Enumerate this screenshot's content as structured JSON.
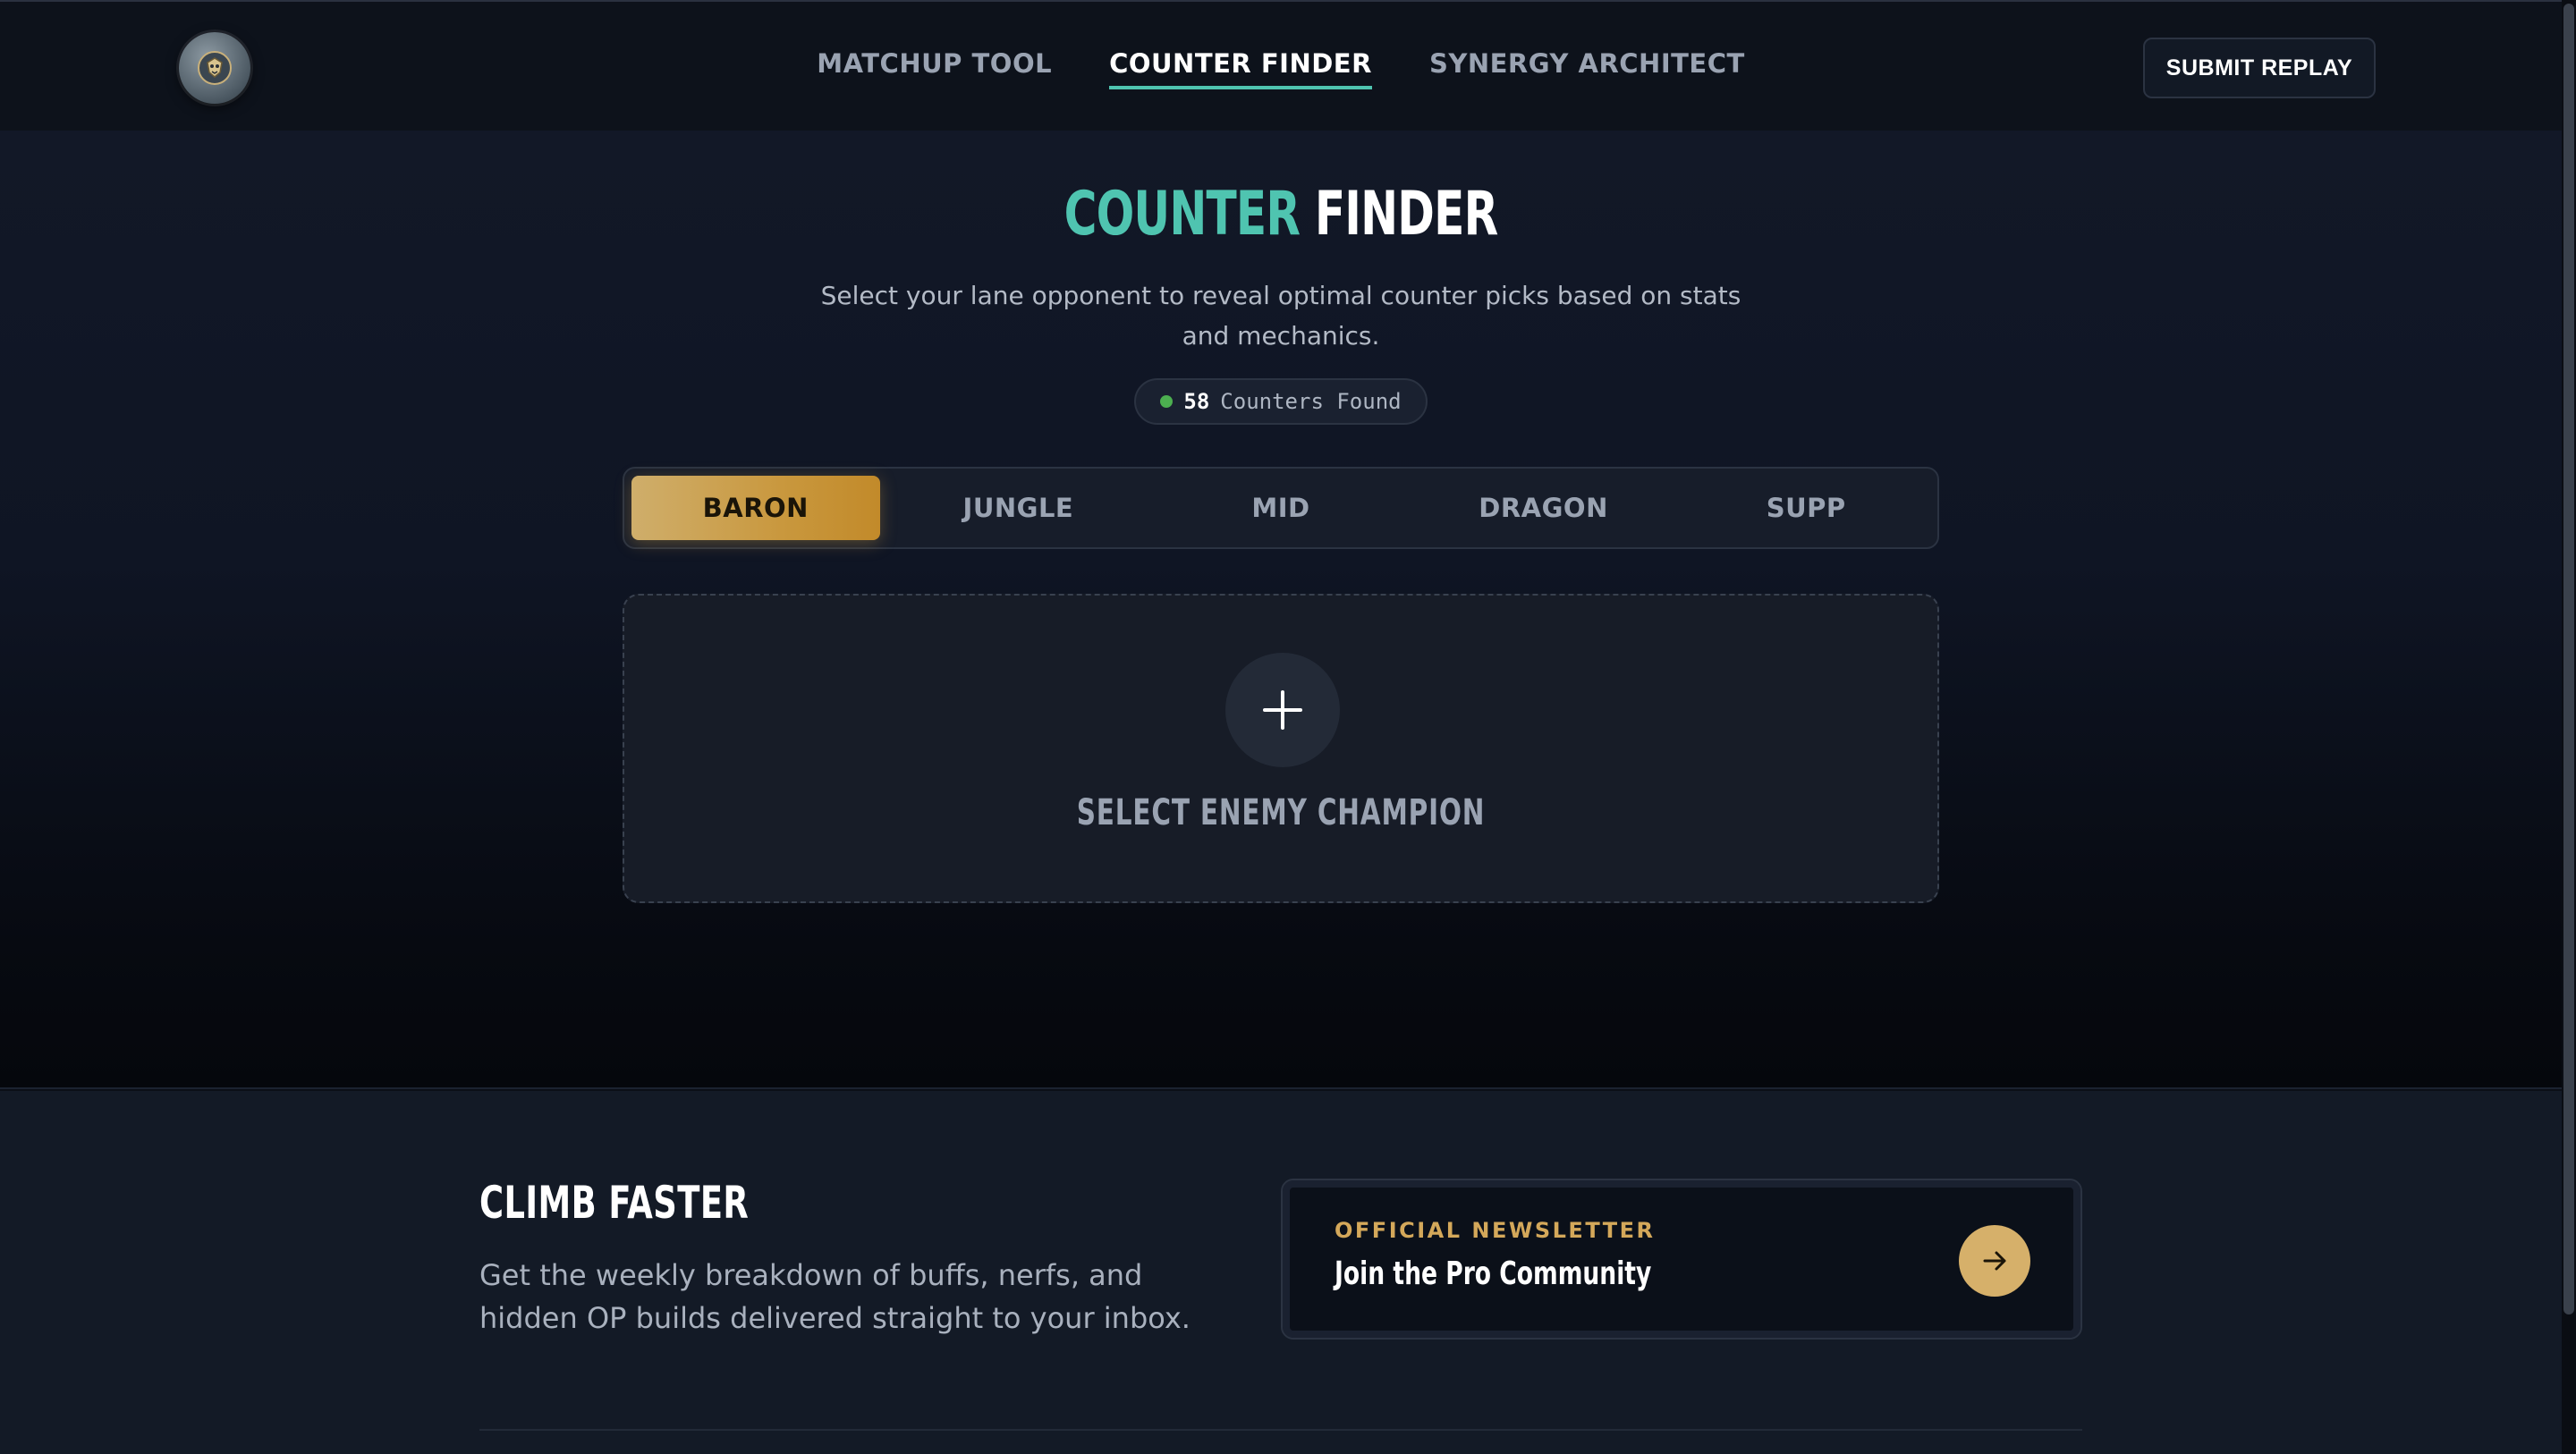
{
  "nav": {
    "logo_icon": "champion-crest-icon",
    "links": [
      {
        "label": "MATCHUP TOOL",
        "active": false
      },
      {
        "label": "COUNTER FINDER",
        "active": true
      },
      {
        "label": "SYNERGY ARCHITECT",
        "active": false
      }
    ],
    "submit_label": "SUBMIT REPLAY"
  },
  "hero": {
    "title_accent": "COUNTER",
    "title_plain": "FINDER",
    "subtitle": "Select your lane opponent to reveal optimal counter picks based on stats and mechanics.",
    "badge": {
      "count": "58",
      "text": "Counters Found",
      "status_color": "#4caf50"
    }
  },
  "lanes": {
    "tabs": [
      "BARON",
      "JUNGLE",
      "MID",
      "DRAGON",
      "SUPP"
    ],
    "active": "BARON"
  },
  "select": {
    "icon": "plus-icon",
    "label": "SELECT ENEMY CHAMPION"
  },
  "footer": {
    "title": "CLIMB FASTER",
    "description": "Get the weekly breakdown of buffs, nerfs, and hidden OP builds delivered straight to your inbox.",
    "newsletter": {
      "kicker": "OFFICIAL NEWSLETTER",
      "title": "Join the Pro Community",
      "icon": "arrow-right-icon"
    }
  },
  "colors": {
    "accent_teal": "#4fc4b0",
    "accent_gold": "#c9983e",
    "background": "#0b0f17"
  }
}
